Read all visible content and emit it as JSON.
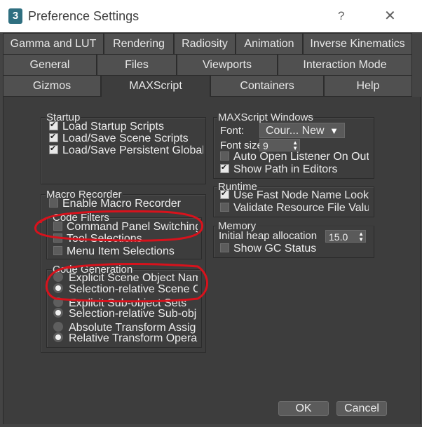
{
  "window": {
    "title": "Preference Settings",
    "app_icon": "3",
    "help": "?",
    "close": "✕"
  },
  "tabs": {
    "row1": [
      "Gamma and LUT",
      "Rendering",
      "Radiosity",
      "Animation",
      "Inverse Kinematics"
    ],
    "row2": [
      "General",
      "Files",
      "Viewports",
      "Interaction Mode"
    ],
    "row3": [
      "Gizmos",
      "MAXScript",
      "Containers",
      "Help"
    ],
    "active": "MAXScript"
  },
  "startup": {
    "label": "Startup",
    "items": [
      {
        "label": "Load Startup Scripts",
        "checked": true
      },
      {
        "label": "Load/Save Scene Scripts",
        "checked": true
      },
      {
        "label": "Load/Save Persistent Global",
        "checked": true
      }
    ]
  },
  "macro_recorder": {
    "label": "Macro Recorder",
    "enable": {
      "label": "Enable Macro Recorder",
      "checked": false
    },
    "code_filters": {
      "label": "Code Filters",
      "items": [
        {
          "label": "Command Panel Switching:",
          "checked": false
        },
        {
          "label": "Tool Selections",
          "checked": false
        },
        {
          "label": "Menu Item Selections",
          "checked": false
        }
      ]
    },
    "code_generation": {
      "label": "Code Generation",
      "items": [
        {
          "label": "Explicit Scene Object Nam",
          "selected": false
        },
        {
          "label": "Selection-relative Scene C",
          "selected": true
        },
        {
          "label": "Explicit Sub-object Sets",
          "selected": false
        },
        {
          "label": "Selection-relative Sub-obj",
          "selected": true
        },
        {
          "label": "Absolute Transform Assig",
          "selected": false
        },
        {
          "label": "Relative Transform Opera",
          "selected": true
        }
      ]
    }
  },
  "maxscript_windows": {
    "label": "MAXScript Windows",
    "font_label": "Font:",
    "font_value": "Cour... New",
    "font_size_label": "Font size",
    "font_size_value": "9",
    "items": [
      {
        "label": "Auto Open Listener On Outr",
        "checked": false
      },
      {
        "label": "Show Path in Editors",
        "checked": true
      }
    ]
  },
  "runtime": {
    "label": "Runtime",
    "items": [
      {
        "label": "Use Fast Node Name Lookuj",
        "checked": true
      },
      {
        "label": "Validate Resource File Value",
        "checked": false
      }
    ]
  },
  "memory": {
    "label": "Memory",
    "heap_label": "Initial heap allocation",
    "heap_value": "15.0",
    "show_gc": {
      "label": "Show GC Status",
      "checked": false
    }
  },
  "buttons": {
    "ok": "OK",
    "cancel": "Cancel"
  },
  "colors": {
    "annotation": "#d8121c",
    "panel_bg": "#3d3d3d",
    "tab_bg": "#505050"
  }
}
